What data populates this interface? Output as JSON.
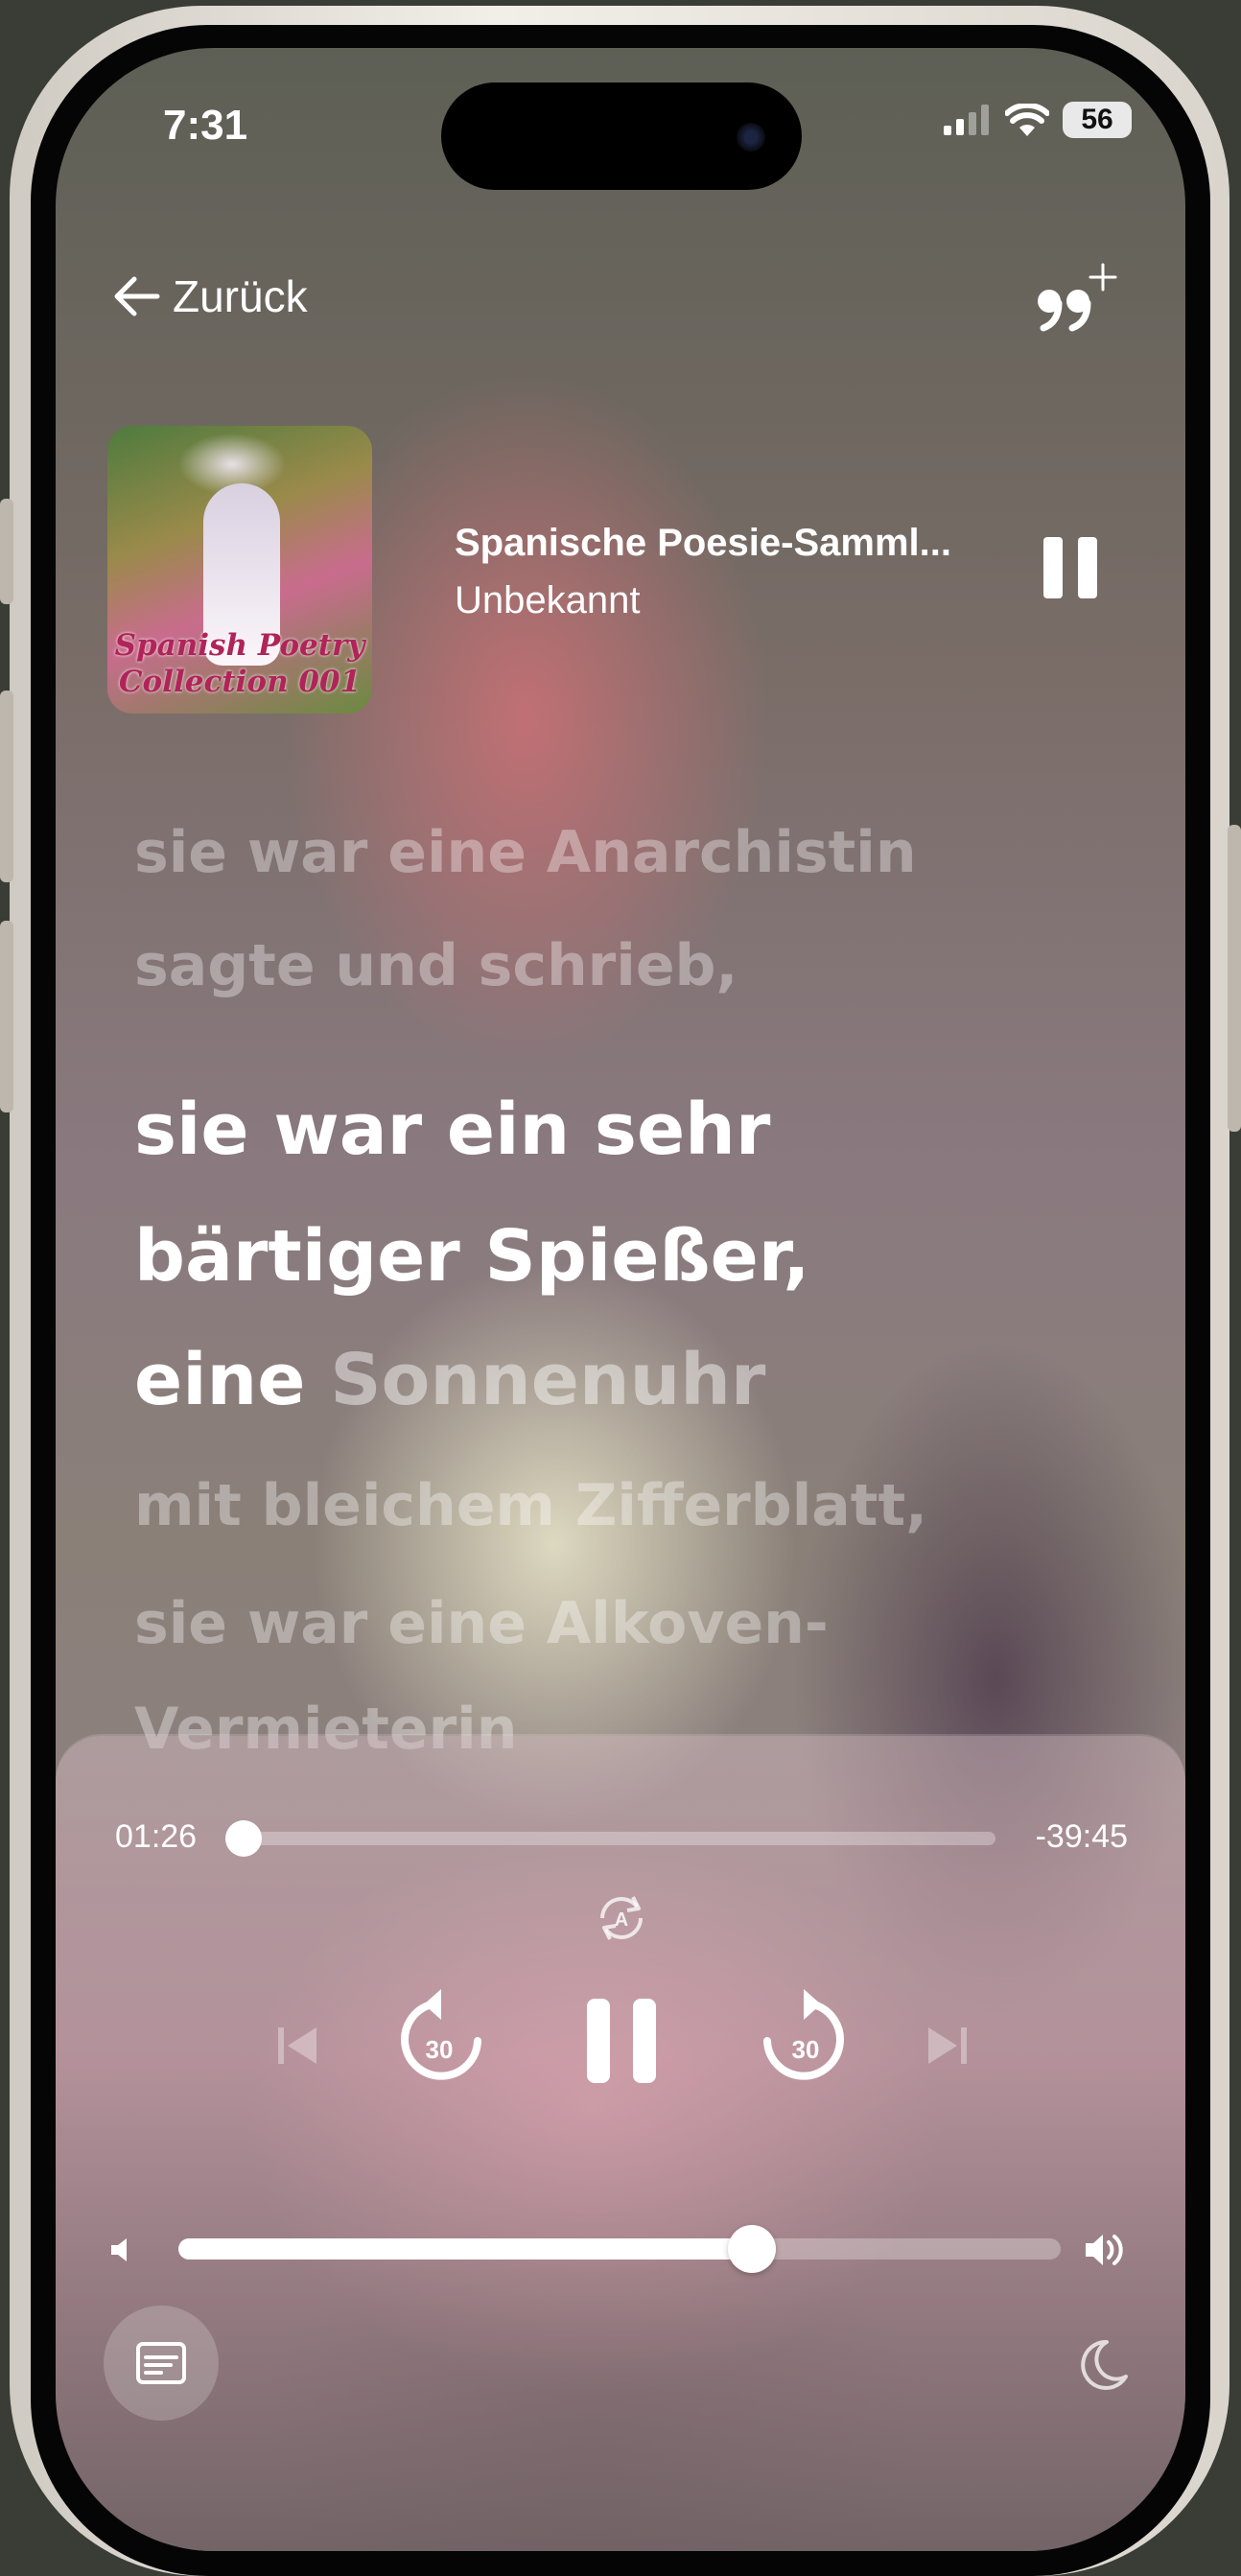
{
  "status_bar": {
    "time": "7:31",
    "battery": "56"
  },
  "nav": {
    "back_label": "Zurück"
  },
  "now_playing": {
    "title": "Spanische Poesie-Samml...",
    "artist": "Unbekannt",
    "cover_text_line1": "Spanish Poetry",
    "cover_text_line2": "Collection 001"
  },
  "lyrics": {
    "previous": [
      "sie war eine Anarchistin",
      "sagte und schrieb,"
    ],
    "current_line1": "sie war ein sehr",
    "current_line2": "bärtiger Spießer,",
    "current_spoken_word": "eine",
    "current_upcoming_word": "Sonnenuhr",
    "upcoming": [
      "mit bleichem Zifferblatt,",
      "sie war eine Alkoven-"
    ],
    "cut_off": "Vermieterin"
  },
  "player": {
    "elapsed": "01:26",
    "remaining": "-39:45",
    "progress_fraction": 0.02,
    "volume_fraction": 0.65,
    "skip_back_seconds": "30",
    "skip_forward_seconds": "30",
    "auto_mode_label": "A"
  },
  "colors": {
    "accent": "#ffffff"
  },
  "icons": [
    "arrow-left-icon",
    "quote-add-icon",
    "pause-icon",
    "auto-scroll-icon",
    "previous-track-icon",
    "rewind-30-icon",
    "forward-30-icon",
    "next-track-icon",
    "volume-low-icon",
    "volume-high-icon",
    "subtitles-icon",
    "sleep-timer-moon-icon"
  ]
}
